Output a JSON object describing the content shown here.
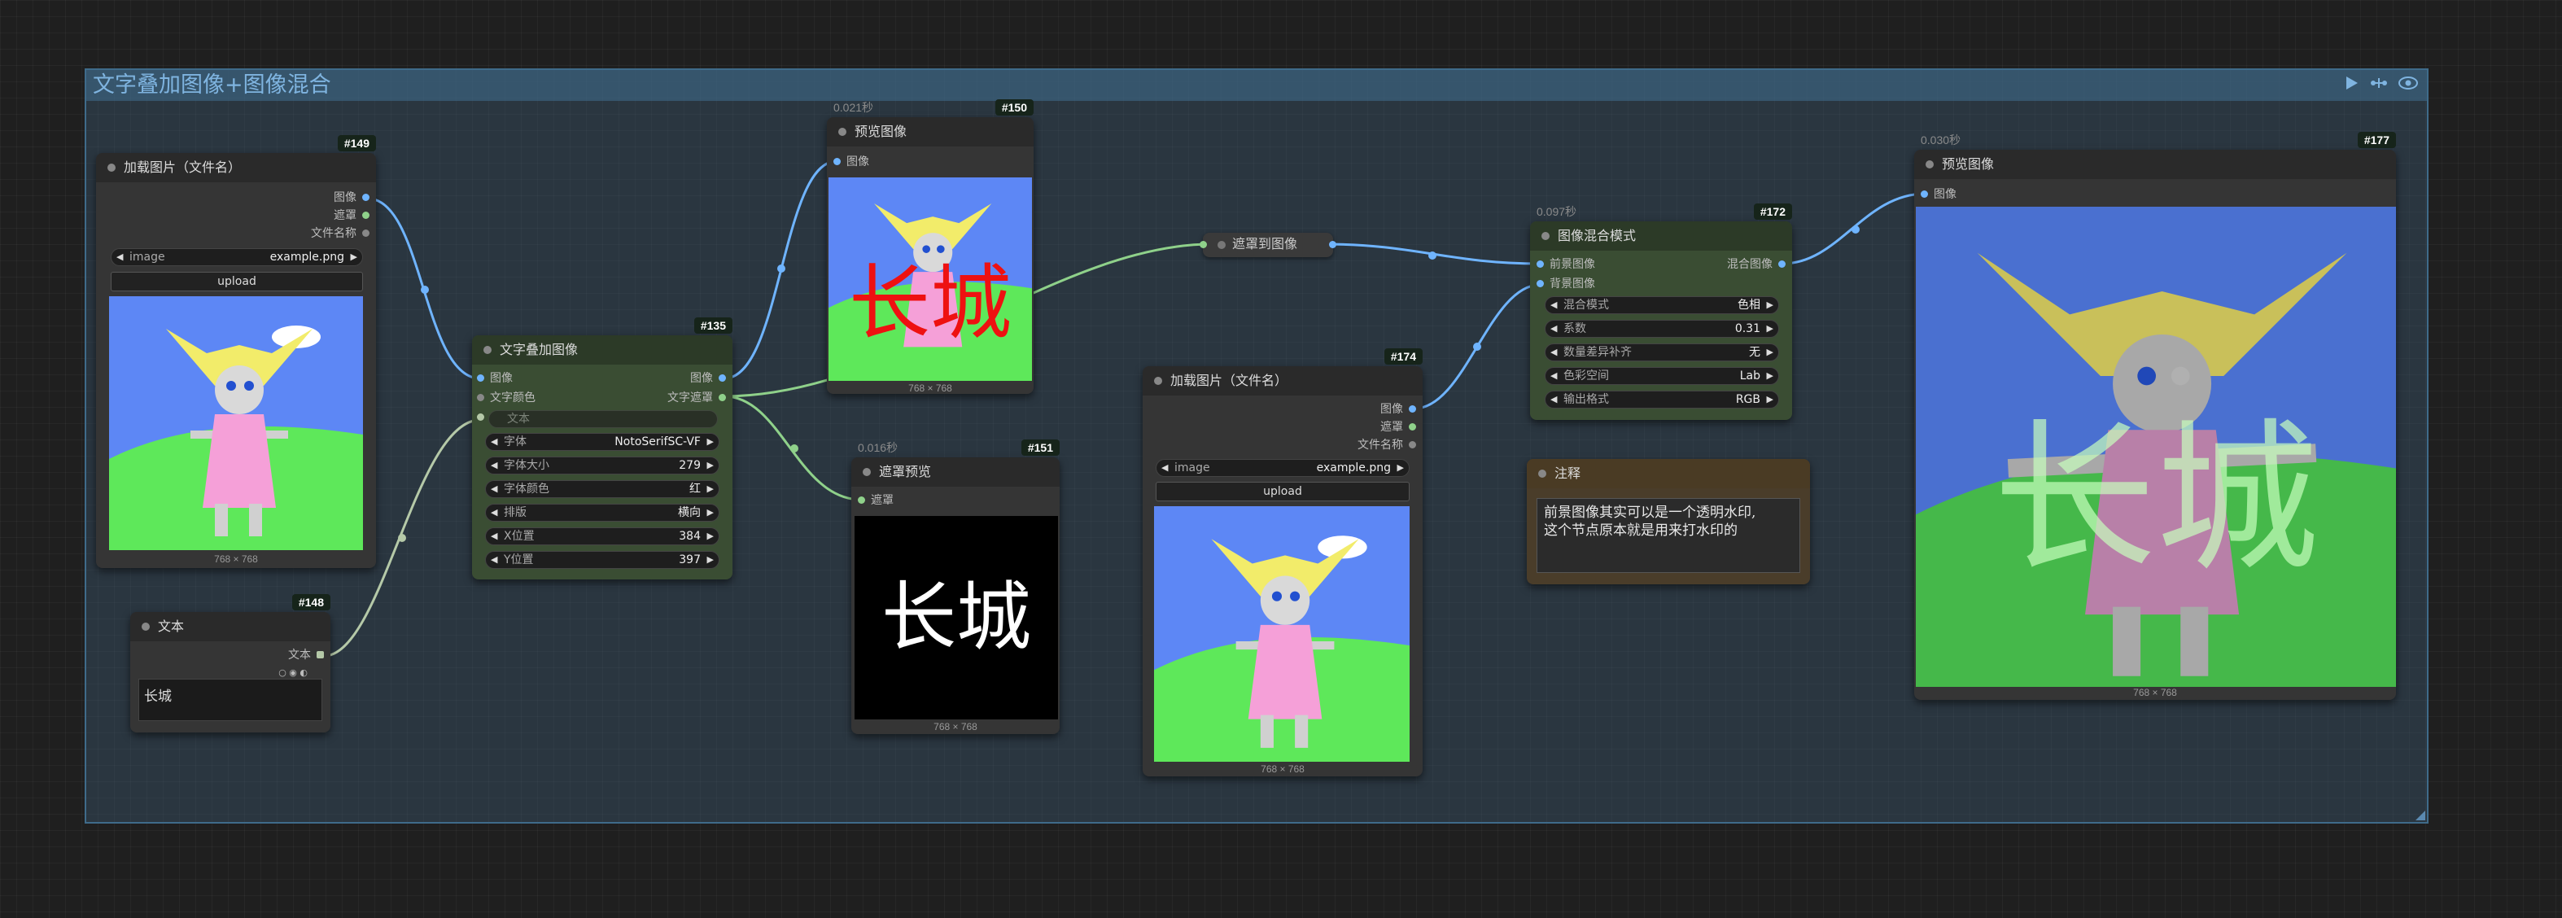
{
  "group": {
    "title": "文字叠加图像+图像混合"
  },
  "colors": {
    "image_link": "#6fb4ff",
    "mask_link": "#8fd18a",
    "text_link": "#b5c9a8",
    "canvas": "#1f1f1f",
    "group_fill": "#2c3e4e",
    "group_border": "#3f6b8a"
  },
  "icons": {
    "run": "play-icon",
    "link": "link-icon",
    "toggle": "eye-icon"
  },
  "nodes": {
    "load149": {
      "id": "#149",
      "title": "加载图片（文件名）",
      "outputs": [
        "图像",
        "遮罩",
        "文件名称"
      ],
      "widget_label": "image",
      "widget_value": "example.png",
      "button": "upload",
      "caption": "768 × 768"
    },
    "text148": {
      "id": "#148",
      "title": "文本",
      "output": "文本",
      "value": "长城"
    },
    "overlay135": {
      "id": "#135",
      "title": "文字叠加图像",
      "inputs": [
        "图像",
        "文字颜色",
        "文本"
      ],
      "outputs": [
        "图像",
        "文字遮罩"
      ],
      "widgets": [
        {
          "label": "字体",
          "value": "NotoSerifSC-VF"
        },
        {
          "label": "字体大小",
          "value": "279"
        },
        {
          "label": "字体颜色",
          "value": "红"
        },
        {
          "label": "排版",
          "value": "横向"
        },
        {
          "label": "X位置",
          "value": "384"
        },
        {
          "label": "Y位置",
          "value": "397"
        }
      ]
    },
    "preview150": {
      "id": "#150",
      "time": "0.021秒",
      "title": "预览图像",
      "input": "图像",
      "caption": "768 × 768",
      "overlay_text": "长城"
    },
    "mask151": {
      "id": "#151",
      "time": "0.016秒",
      "title": "遮罩预览",
      "input": "遮罩",
      "caption": "768 × 768",
      "overlay_text": "长城"
    },
    "mask2img": {
      "title": "遮罩到图像"
    },
    "load174": {
      "id": "#174",
      "title": "加载图片（文件名）",
      "outputs": [
        "图像",
        "遮罩",
        "文件名称"
      ],
      "widget_label": "image",
      "widget_value": "example.png",
      "button": "upload",
      "caption": "768 × 768"
    },
    "blend172": {
      "id": "#172",
      "time": "0.097秒",
      "title": "图像混合模式",
      "inputs": [
        "前景图像",
        "背景图像"
      ],
      "output": "混合图像",
      "widgets": [
        {
          "label": "混合模式",
          "value": "色相"
        },
        {
          "label": "系数",
          "value": "0.31"
        },
        {
          "label": "数量差异补齐",
          "value": "无"
        },
        {
          "label": "色彩空间",
          "value": "Lab"
        },
        {
          "label": "输出格式",
          "value": "RGB"
        }
      ]
    },
    "note": {
      "title": "注释",
      "text": "前景图像其实可以是一个透明水印,\n这个节点原本就是用来打水印的"
    },
    "preview177": {
      "id": "#177",
      "time": "0.030秒",
      "title": "预览图像",
      "input": "图像",
      "caption": "768 × 768",
      "overlay_text": "长城"
    }
  }
}
